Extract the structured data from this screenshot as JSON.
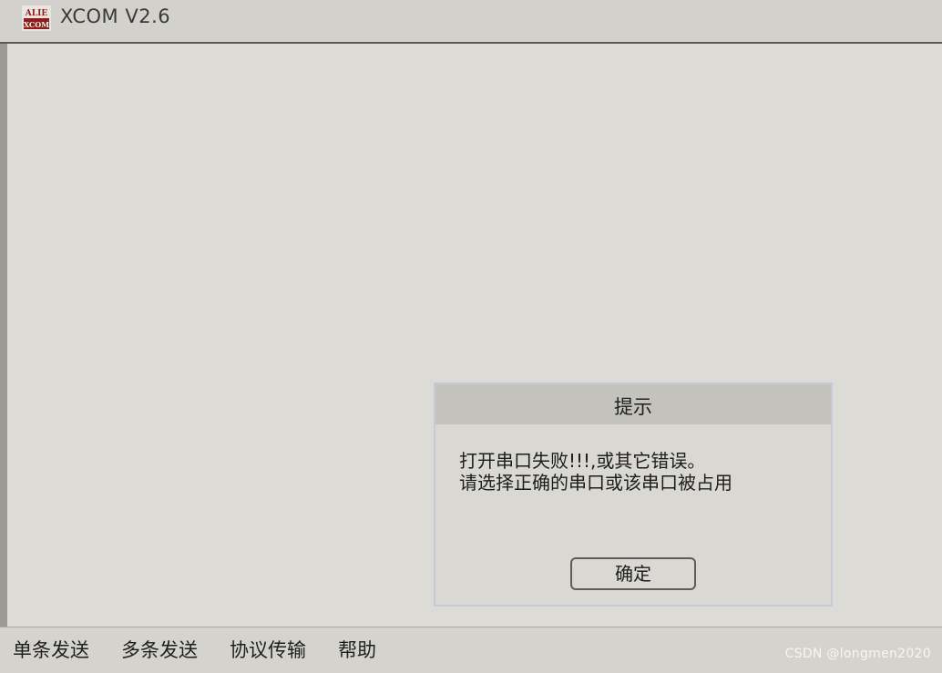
{
  "window": {
    "title": "XCOM V2.6",
    "logo_text_top": "ALIE",
    "logo_text_bottom": "XCOM",
    "logo_color": "#8b1d1d"
  },
  "dialog": {
    "title": "提示",
    "message_line1": "打开串口失败!!!,或其它错误。",
    "message_line2": "请选择正确的串口或该串口被占用",
    "ok_label": "确定"
  },
  "bottom_tabs": [
    {
      "label": "单条发送"
    },
    {
      "label": "多条发送"
    },
    {
      "label": "协议传输"
    },
    {
      "label": "帮助"
    }
  ],
  "watermark": "CSDN @longmen2020",
  "colors": {
    "background": "#d6d5cf",
    "dialog_header": "#c3c2bd",
    "titlebar_border": "#5a5a58",
    "logo": "#8b1d1d"
  }
}
